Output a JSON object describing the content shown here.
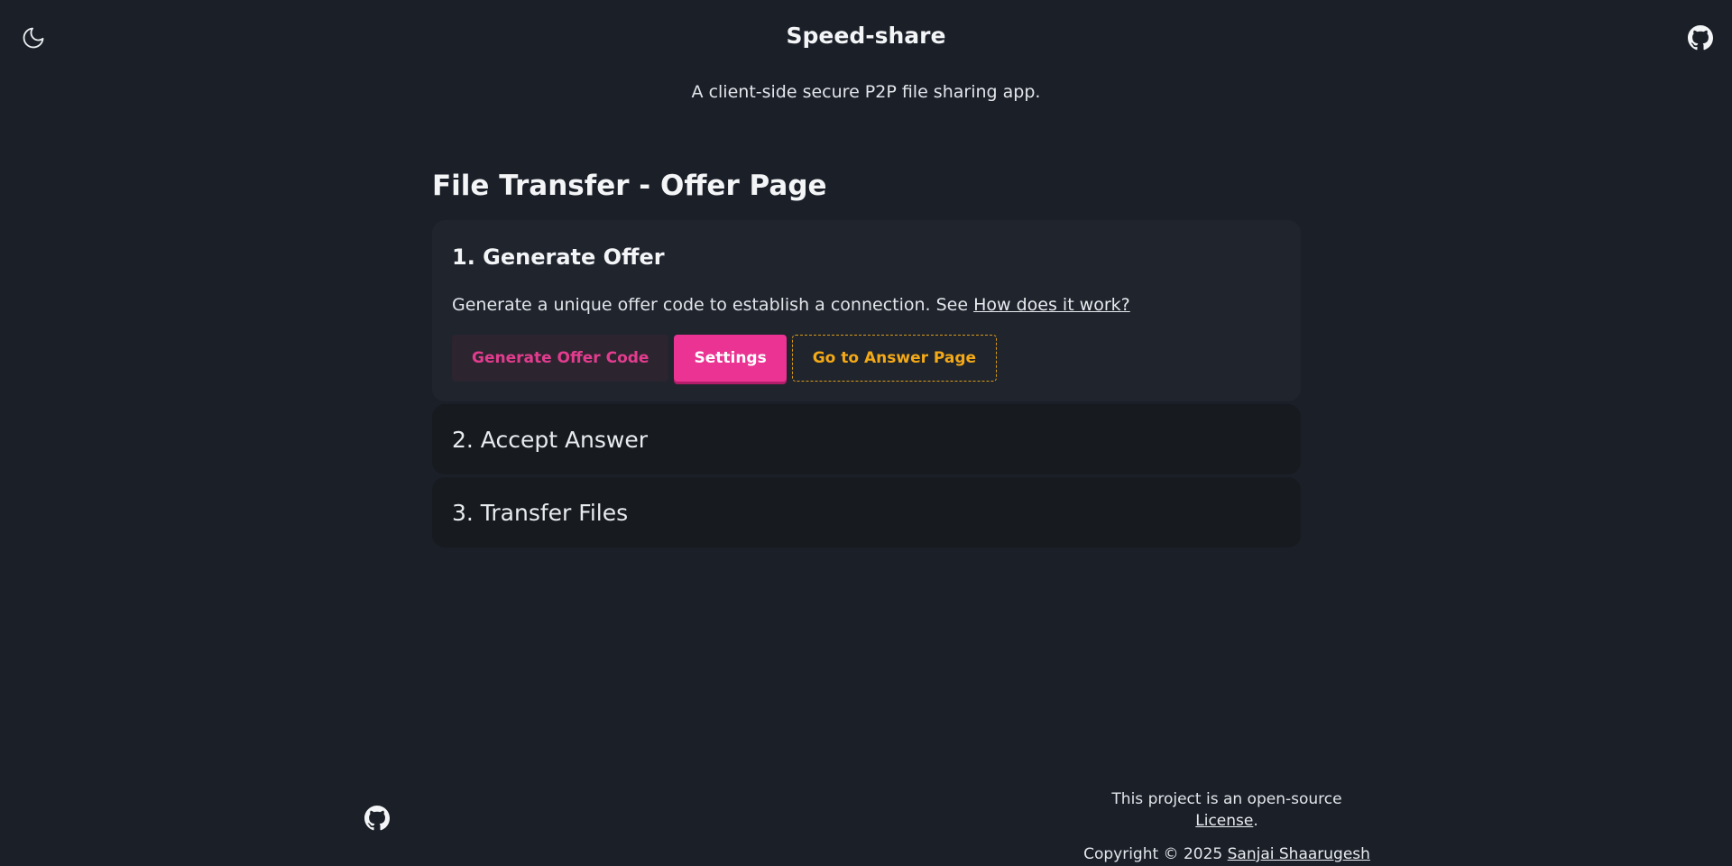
{
  "header": {
    "title": "Speed-share",
    "subtitle": "A client-side secure P2P file sharing app.",
    "theme_icon": "moon-icon",
    "github_icon": "github-icon"
  },
  "main": {
    "page_title": "File Transfer - Offer Page",
    "steps": [
      {
        "title": "1. Generate Offer",
        "expanded": true,
        "description": "Generate a unique offer code to establish a connection. See",
        "link_text": "How does it work?",
        "buttons": [
          {
            "label": "Generate Offer Code"
          },
          {
            "label": "Settings"
          },
          {
            "label": "Go to Answer Page"
          }
        ]
      },
      {
        "title": "2. Accept Answer",
        "expanded": false
      },
      {
        "title": "3. Transfer Files",
        "expanded": false
      }
    ]
  },
  "footer": {
    "license_prefix": "This project is an open-source",
    "license_link": "License",
    "license_suffix": ".",
    "copyright_prefix": "Copyright © 2025",
    "author_link": "Sanjai Shaarugesh"
  },
  "colors": {
    "background": "#1b1f28",
    "accent_pink": "#ea3392",
    "accent_amber": "#f4a917"
  }
}
